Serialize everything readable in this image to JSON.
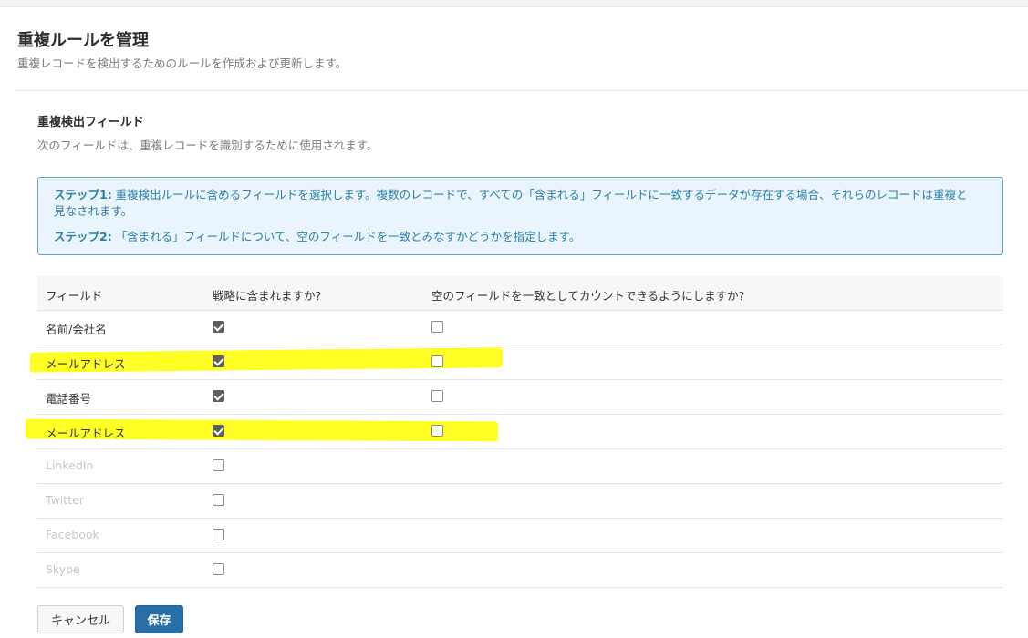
{
  "header": {
    "title": "重複ルールを管理",
    "subtitle": "重複レコードを検出するためのルールを作成および更新します。"
  },
  "section": {
    "title": "重複検出フィールド",
    "description": "次のフィールドは、重複レコードを識別するために使用されます。"
  },
  "info": {
    "step1_label": "ステップ1:",
    "step1_text": " 重複検出ルールに含めるフィールドを選択します。複数のレコードで、すべての「含まれる」フィールドに一致するデータが存在する場合、それらのレコードは重複と見なされます。",
    "step2_label": "ステップ2:",
    "step2_text": " 「含まれる」フィールドについて、空のフィールドを一致とみなすかどうかを指定します。"
  },
  "table": {
    "columns": [
      "フィールド",
      "戦略に含まれますか?",
      "空のフィールドを一致としてカウントできるようにしますか?"
    ],
    "rows": [
      {
        "name": "名前/会社名",
        "included": true,
        "allow_blank": false,
        "enabled": true,
        "highlighted": false
      },
      {
        "name": "メールアドレス",
        "included": true,
        "allow_blank": false,
        "enabled": true,
        "highlighted": true
      },
      {
        "name": "電話番号",
        "included": true,
        "allow_blank": false,
        "enabled": true,
        "highlighted": false
      },
      {
        "name": "メールアドレス",
        "included": true,
        "allow_blank": false,
        "enabled": true,
        "highlighted": true
      },
      {
        "name": "LinkedIn",
        "included": false,
        "allow_blank": null,
        "enabled": false,
        "highlighted": false
      },
      {
        "name": "Twitter",
        "included": false,
        "allow_blank": null,
        "enabled": false,
        "highlighted": false
      },
      {
        "name": "Facebook",
        "included": false,
        "allow_blank": null,
        "enabled": false,
        "highlighted": false
      },
      {
        "name": "Skype",
        "included": false,
        "allow_blank": null,
        "enabled": false,
        "highlighted": false
      }
    ]
  },
  "buttons": {
    "cancel_label": "キャンセル",
    "save_label": "保存"
  },
  "colors": {
    "accent": "#2a6ea6",
    "info_text": "#2b7fa5",
    "info_background": "#e9f4fc",
    "highlight": "#ffff00"
  }
}
